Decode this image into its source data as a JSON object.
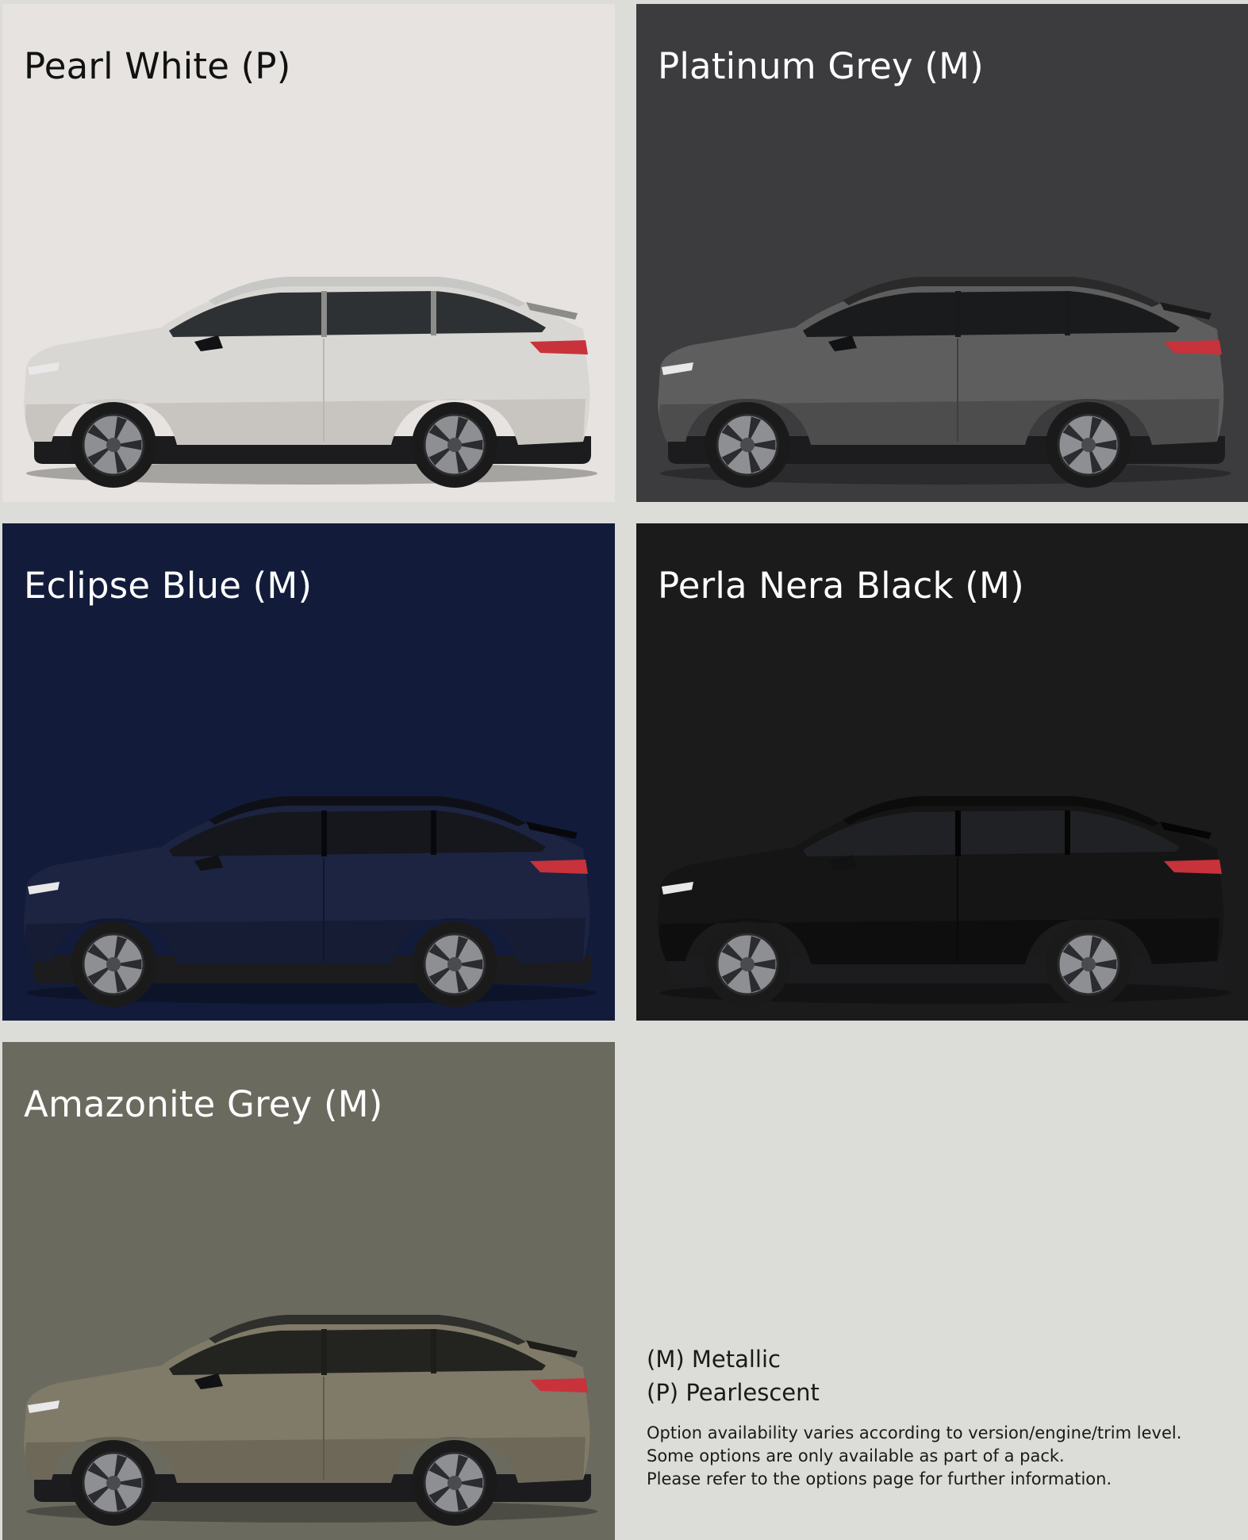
{
  "swatches": [
    {
      "title": "Pearl White (P)",
      "tile_bg": "#e6e3e0",
      "title_color": "#111111",
      "body_color": "#d9d7d3",
      "body_shade": "#b9b7b3",
      "glass": "#2d3134",
      "roof": "#c7c7c5",
      "roof_shade": "#8c8c8a"
    },
    {
      "title": "Platinum Grey (M)",
      "tile_bg": "#3c3b3d",
      "title_color": "#ffffff",
      "body_color": "#5e5e5e",
      "body_shade": "#3f3f40",
      "glass": "#1a1b1d",
      "roof": "#2a2a2b",
      "roof_shade": "#1a1a1b"
    },
    {
      "title": "Eclipse Blue (M)",
      "tile_bg": "#121c3a",
      "title_color": "#ffffff",
      "body_color": "#1c2442",
      "body_shade": "#10152a",
      "glass": "#15171d",
      "roof": "#0f1017",
      "roof_shade": "#08080c"
    },
    {
      "title": "Perla Nera Black (M)",
      "tile_bg": "#1b1b1c",
      "title_color": "#ffffff",
      "body_color": "#151516",
      "body_shade": "#0a0a0b",
      "glass": "#202124",
      "roof": "#0c0c0d",
      "roof_shade": "#050506"
    },
    {
      "title": "Amazonite Grey (M)",
      "tile_bg": "#6b6a5f",
      "title_color": "#ffffff",
      "body_color": "#807a68",
      "body_shade": "#5e5a4c",
      "glass": "#23241f",
      "roof": "#2f2f2b",
      "roof_shade": "#1d1d1a"
    }
  ],
  "legend": {
    "metallic": "(M) Metallic",
    "pearlescent": "(P) Pearlescent",
    "note_1": "Option availability varies according to version/engine/trim level.",
    "note_2": "Some options are only available as part of a pack.",
    "note_3": "Please refer to the options page for further information."
  },
  "colors": {
    "page_bg": "#dcdcd8",
    "tail_light": "#c8323a",
    "tyre": "#1a1a1a",
    "rim": "#8d8f92"
  }
}
